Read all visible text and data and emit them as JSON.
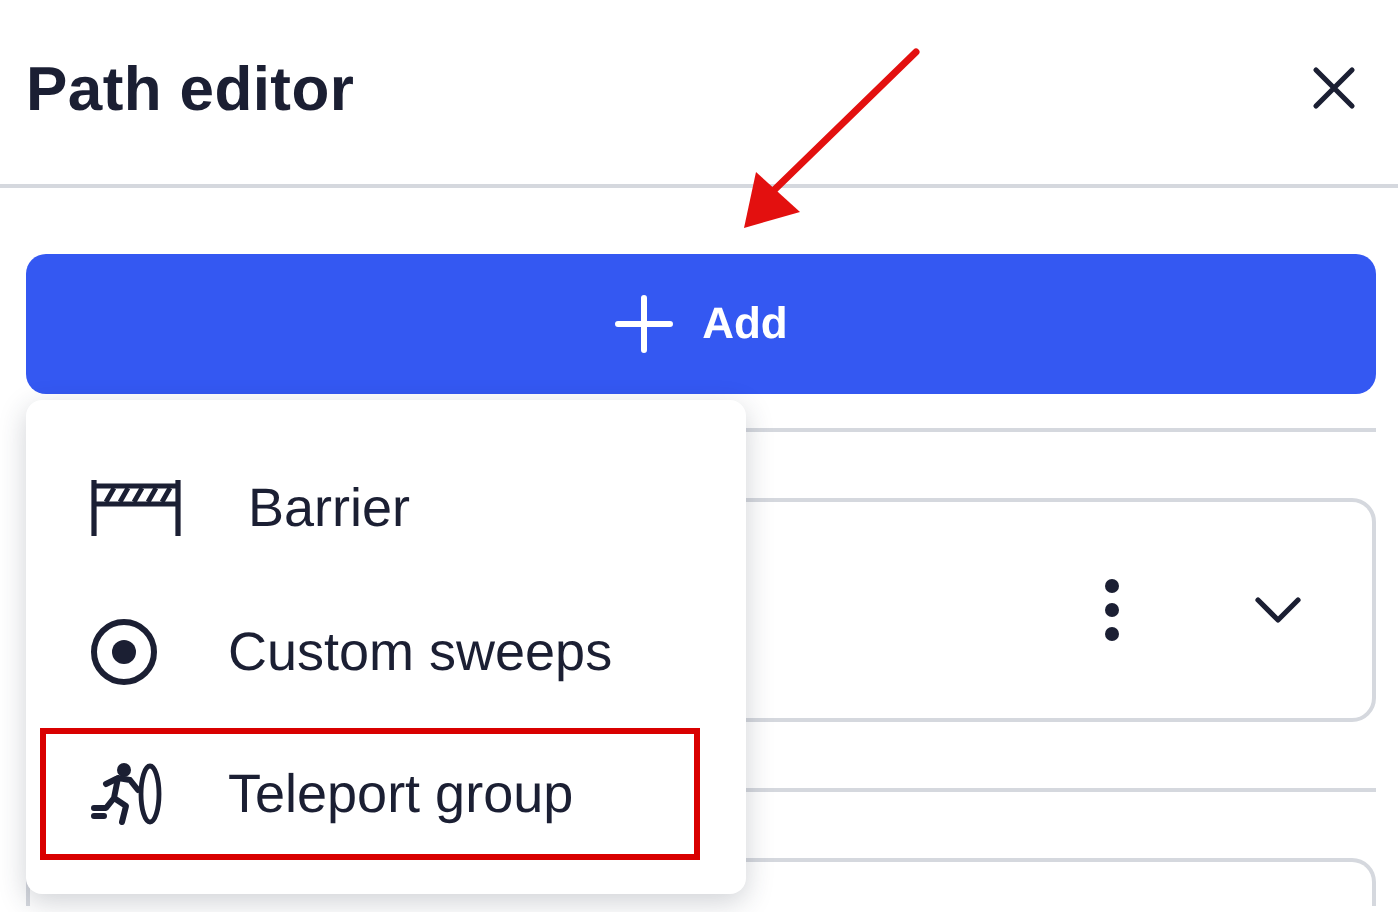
{
  "panel": {
    "title": "Path editor"
  },
  "add_button": {
    "label": "Add"
  },
  "menu": {
    "items": [
      {
        "label": "Barrier",
        "kind": "barrier",
        "highlighted": false
      },
      {
        "label": "Custom sweeps",
        "kind": "sweep",
        "highlighted": false
      },
      {
        "label": "Teleport group",
        "kind": "teleport",
        "highlighted": true
      }
    ]
  },
  "annotation": {
    "kind": "arrow"
  }
}
